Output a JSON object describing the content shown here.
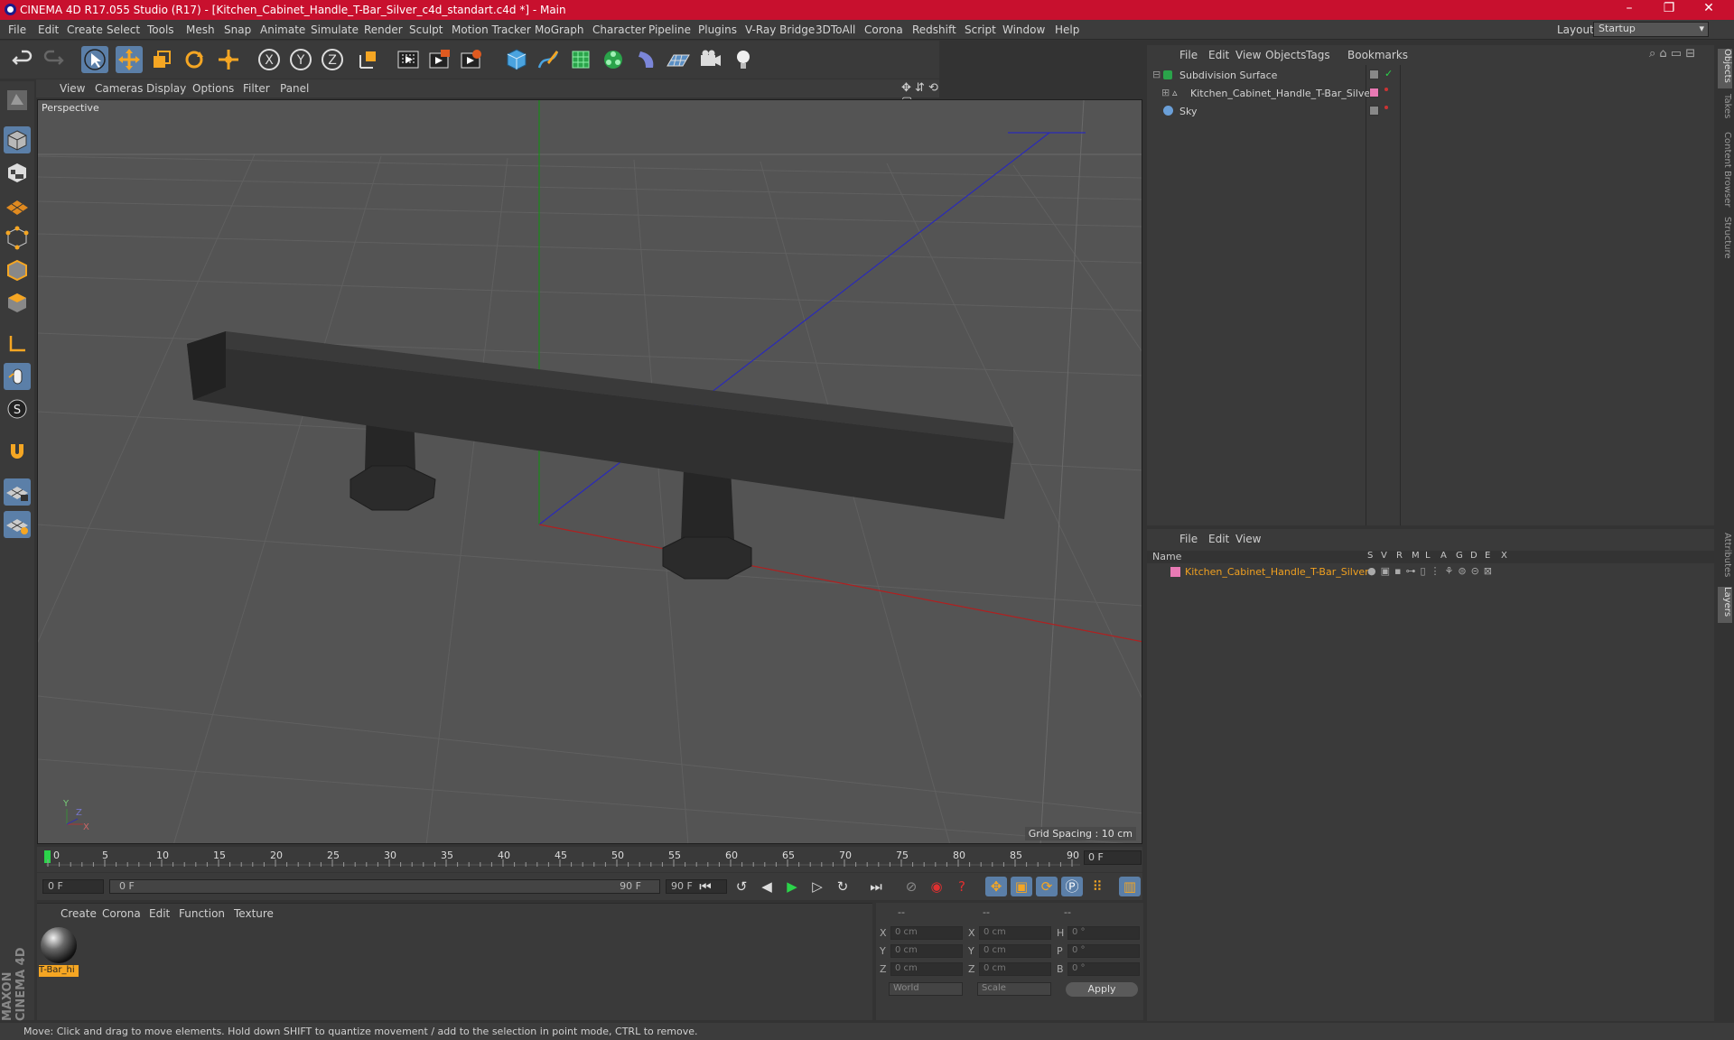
{
  "window": {
    "title": "CINEMA 4D R17.055 Studio (R17) - [Kitchen_Cabinet_Handle_T-Bar_Silver_c4d_standart.c4d *] - Main",
    "minimize": "–",
    "restore": "❐",
    "close": "✕"
  },
  "menu": [
    "File",
    "Edit",
    "Create",
    "Select",
    "Tools",
    "Mesh",
    "Snap",
    "Animate",
    "Simulate",
    "Render",
    "Sculpt",
    "Motion Tracker",
    "MoGraph",
    "Character",
    "Pipeline",
    "Plugins",
    "V-Ray Bridge",
    "3DToAll",
    "Corona",
    "Redshift",
    "Script",
    "Window",
    "Help"
  ],
  "layout": {
    "label": "Layout:",
    "value": "Startup"
  },
  "viewport": {
    "menu": [
      "View",
      "Cameras",
      "Display",
      "Options",
      "Filter",
      "Panel"
    ],
    "camera": "Perspective",
    "grid_spacing": "Grid Spacing : 10 cm"
  },
  "timeline": {
    "ticks": [
      "0",
      "5",
      "10",
      "15",
      "20",
      "25",
      "30",
      "35",
      "40",
      "45",
      "50",
      "55",
      "60",
      "65",
      "70",
      "75",
      "80",
      "85",
      "90"
    ],
    "current": "0 F",
    "start": "0 F",
    "range_start": "0 F",
    "range_end": "90 F",
    "end": "90 F"
  },
  "material_panel": {
    "menu": [
      "Create",
      "Corona",
      "Edit",
      "Function",
      "Texture"
    ],
    "material_name": "T-Bar_hi"
  },
  "coords": {
    "header": [
      "--",
      "--",
      "--"
    ],
    "rows": [
      {
        "a": "X",
        "av": "0 cm",
        "b": "X",
        "bv": "0 cm",
        "c": "H",
        "cv": "0 °"
      },
      {
        "a": "Y",
        "av": "0 cm",
        "b": "Y",
        "bv": "0 cm",
        "c": "P",
        "cv": "0 °"
      },
      {
        "a": "Z",
        "av": "0 cm",
        "b": "Z",
        "bv": "0 cm",
        "c": "B",
        "cv": "0 °"
      }
    ],
    "world": "World",
    "scale": "Scale",
    "apply": "Apply"
  },
  "objects_panel": {
    "menu": [
      "File",
      "Edit",
      "View",
      "Objects",
      "Tags",
      "Bookmarks"
    ],
    "items": [
      "Subdivision Surface",
      "Kitchen_Cabinet_Handle_T-Bar_Silver",
      "Sky"
    ]
  },
  "layers_panel": {
    "menu": [
      "File",
      "Edit",
      "View"
    ],
    "name_header": "Name",
    "cols": [
      "S",
      "V",
      "R",
      "M",
      "L",
      "A",
      "G",
      "D",
      "E",
      "X"
    ],
    "layer": "Kitchen_Cabinet_Handle_T-Bar_Silver"
  },
  "right_tabs": [
    "Objects",
    "Takes",
    "Content Browser",
    "Structure",
    "Attributes",
    "Layers"
  ],
  "brand": "MAXON CINEMA 4D",
  "status": "Move: Click and drag to move elements. Hold down SHIFT to quantize movement / add to the selection in point mode, CTRL to remove.",
  "colors": {
    "title_bar": "#c8102e",
    "accent": "#5b7fa8",
    "layer_color": "#e87ab4",
    "layer_text": "#f0a020"
  }
}
